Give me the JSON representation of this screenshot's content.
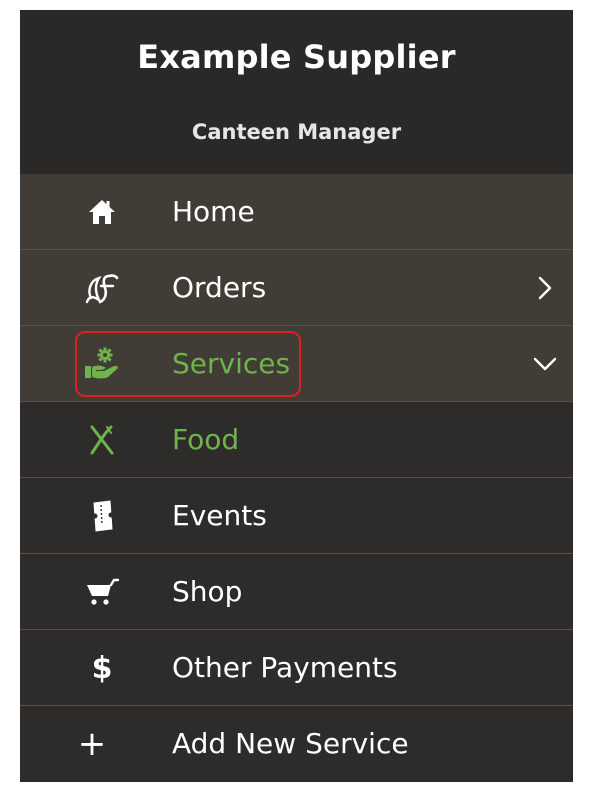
{
  "header": {
    "title": "Example Supplier",
    "subtitle": "Canteen Manager"
  },
  "colors": {
    "accent_green": "#6fb34d",
    "highlight_red": "#e0201f"
  },
  "menu": [
    {
      "label": "Home",
      "icon": "home-icon"
    },
    {
      "label": "Orders",
      "icon": "orders-logo-icon",
      "chevron": "right"
    },
    {
      "label": "Services",
      "icon": "services-hand-gear-icon",
      "chevron": "down",
      "active": true,
      "highlighted": true
    },
    {
      "label": "Food",
      "icon": "fork-knife-icon",
      "active": true
    },
    {
      "label": "Events",
      "icon": "ticket-icon"
    },
    {
      "label": "Shop",
      "icon": "cart-icon"
    },
    {
      "label": "Other Payments",
      "icon": "dollar-icon"
    },
    {
      "label": "Add New Service",
      "icon": "plus-icon"
    }
  ]
}
